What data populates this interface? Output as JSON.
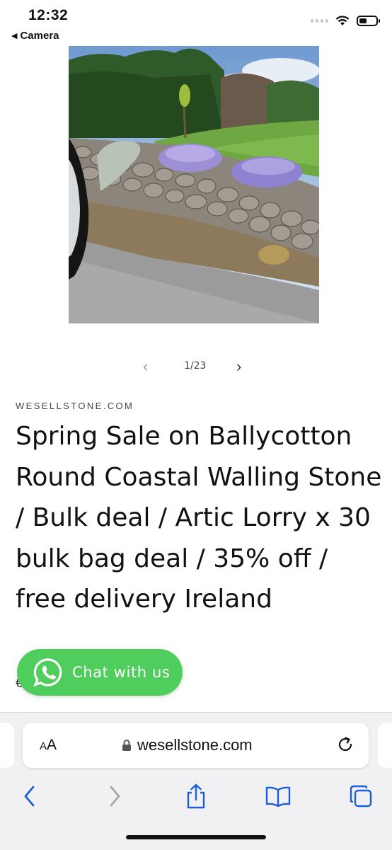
{
  "status_bar": {
    "time": "12:32",
    "back_label": "Camera"
  },
  "product": {
    "image_icon": "product-photo-stone-wall",
    "pager": {
      "prev_icon": "chevron-left-icon",
      "count": "1/23",
      "next_icon": "chevron-right-icon"
    },
    "vendor": "WESELLSTONE.COM",
    "title": "Spring Sale on Ballycotton Round Coastal Walling Stone / Bulk deal / Artic Lorry x 30 bulk bag deal / 35% off / free delivery Ireland",
    "price_peek": "€"
  },
  "chat_widget": {
    "label": "Chat with us",
    "icon": "whatsapp-icon",
    "color": "#4fce5d"
  },
  "browser": {
    "text_size_label_big": "A",
    "text_size_label_small": "A",
    "url": "wesellstone.com",
    "lock_icon": "lock-icon",
    "reload_icon": "reload-icon",
    "toolbar": [
      "back-icon",
      "forward-icon",
      "share-icon",
      "bookmarks-icon",
      "tabs-icon"
    ],
    "accent_color": "#1a5fd6"
  }
}
